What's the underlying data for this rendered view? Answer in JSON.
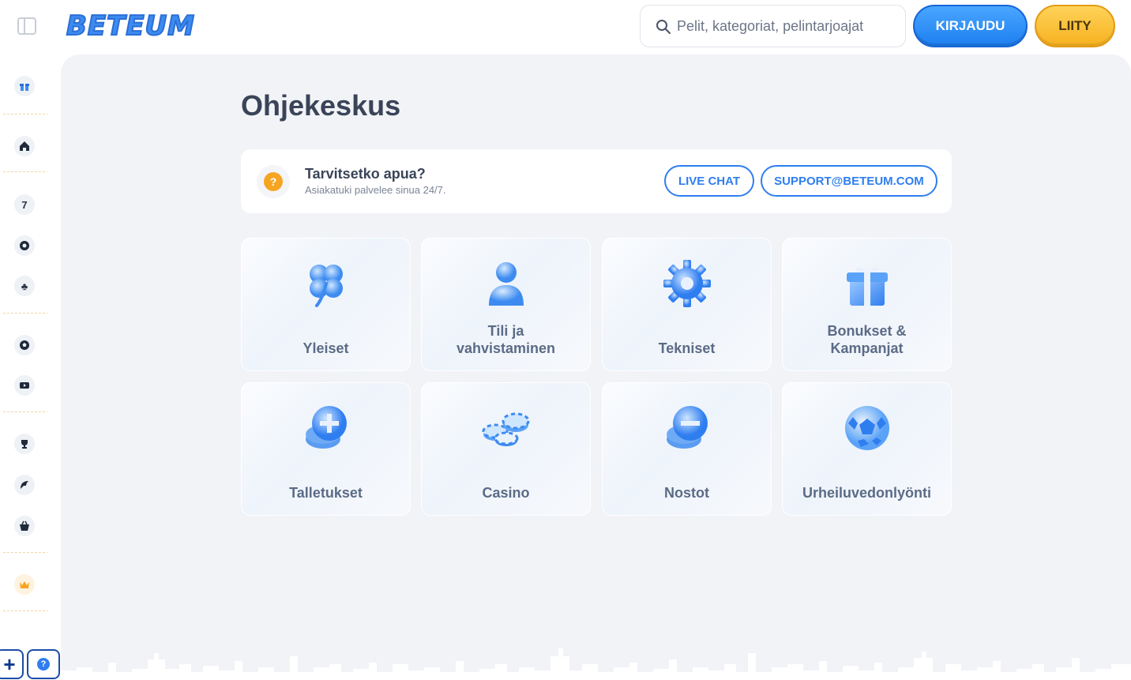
{
  "header": {
    "logo_text": "BETEUM",
    "search_placeholder": "Pelit, kategoriat, pelintarjoajat",
    "login_label": "KIRJAUDU",
    "join_label": "LIITY"
  },
  "sidebar": {
    "icons": [
      "gift-icon",
      "home-icon",
      "slot-seven-icon",
      "roulette-icon",
      "clover-icon",
      "soccer-ball-icon",
      "youtube-icon",
      "trophy-icon",
      "esports-icon",
      "shop-basket-icon",
      "crown-icon"
    ],
    "bottom_plus": "+",
    "bottom_help": "?"
  },
  "main": {
    "title": "Ohjekeskus",
    "help": {
      "title": "Tarvitsetko apua?",
      "subtitle": "Asiakatuki palvelee sinua 24/7.",
      "chat_label": "LIVE CHAT",
      "email_label": "SUPPORT@BETEUM.COM",
      "icon_glyph": "?"
    },
    "categories": [
      {
        "label": "Yleiset",
        "icon": "clover-icon"
      },
      {
        "label": "Tili ja vahvistaminen",
        "line1": "Tili ja",
        "line2": "vahvistaminen",
        "icon": "user-icon"
      },
      {
        "label": "Tekniset",
        "icon": "gear-icon"
      },
      {
        "label": "Bonukset & Kampanjat",
        "line1": "Bonukset &",
        "line2": "Kampanjat",
        "icon": "gift-icon"
      },
      {
        "label": "Talletukset",
        "icon": "deposit-coin-icon"
      },
      {
        "label": "Casino",
        "icon": "casino-chips-icon"
      },
      {
        "label": "Nostot",
        "icon": "withdraw-coin-icon"
      },
      {
        "label": "Urheiluvedonlyönti",
        "icon": "soccer-ball-icon"
      }
    ]
  },
  "colors": {
    "primary_blue": "#2f7ef0",
    "join_orange": "#f6b11f",
    "help_orange": "#f6a523",
    "background": "#f2f3f7"
  }
}
